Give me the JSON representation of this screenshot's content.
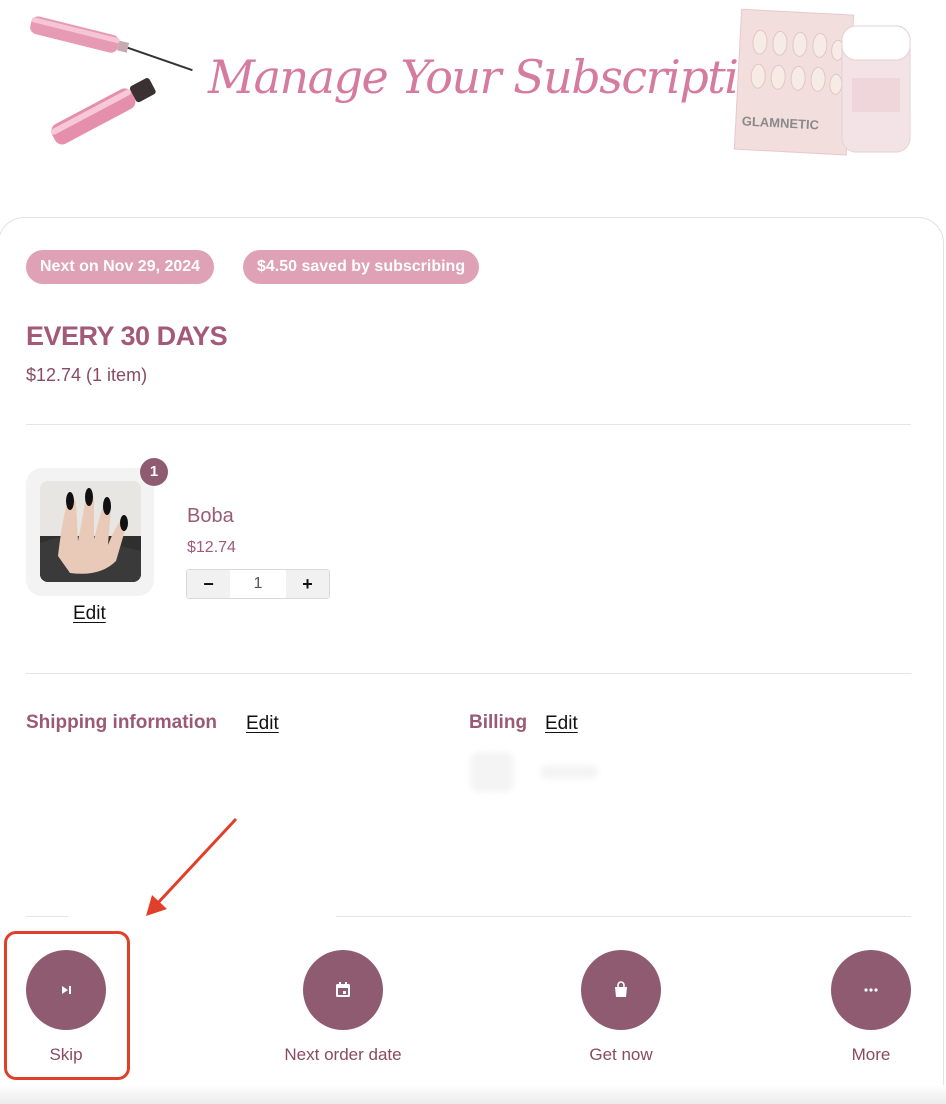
{
  "banner": {
    "title": "Manage Your Subscriptions",
    "mascara_brand": "GLAMNETIC",
    "nails_brand": "GLAMNETIC"
  },
  "subscription": {
    "next_badge": "Next on Nov 29, 2024",
    "saved_badge": "$4.50 saved by subscribing",
    "frequency": "EVERY 30 DAYS",
    "subtotal": "$12.74 (1 item)"
  },
  "product": {
    "quantity_badge": "1",
    "edit_label": "Edit",
    "name": "Boba",
    "price": "$12.74",
    "decrement_label": "−",
    "quantity": "1",
    "increment_label": "+"
  },
  "shipping": {
    "heading": "Shipping information",
    "edit_label": "Edit"
  },
  "billing": {
    "heading": "Billing",
    "edit_label": "Edit"
  },
  "actions": {
    "skip_label": "Skip",
    "next_order_date_label": "Next order date",
    "get_now_label": "Get now",
    "more_label": "More"
  },
  "colors": {
    "accent": "#8f5b70",
    "badge_bg": "#dfa1b5",
    "title_pink": "#d67ba0",
    "annotation_red": "#e0402a"
  },
  "icons": {
    "skip": "skip-next-icon",
    "next_order_date": "calendar-icon",
    "get_now": "shopping-bag-icon",
    "more": "more-dots-icon"
  }
}
